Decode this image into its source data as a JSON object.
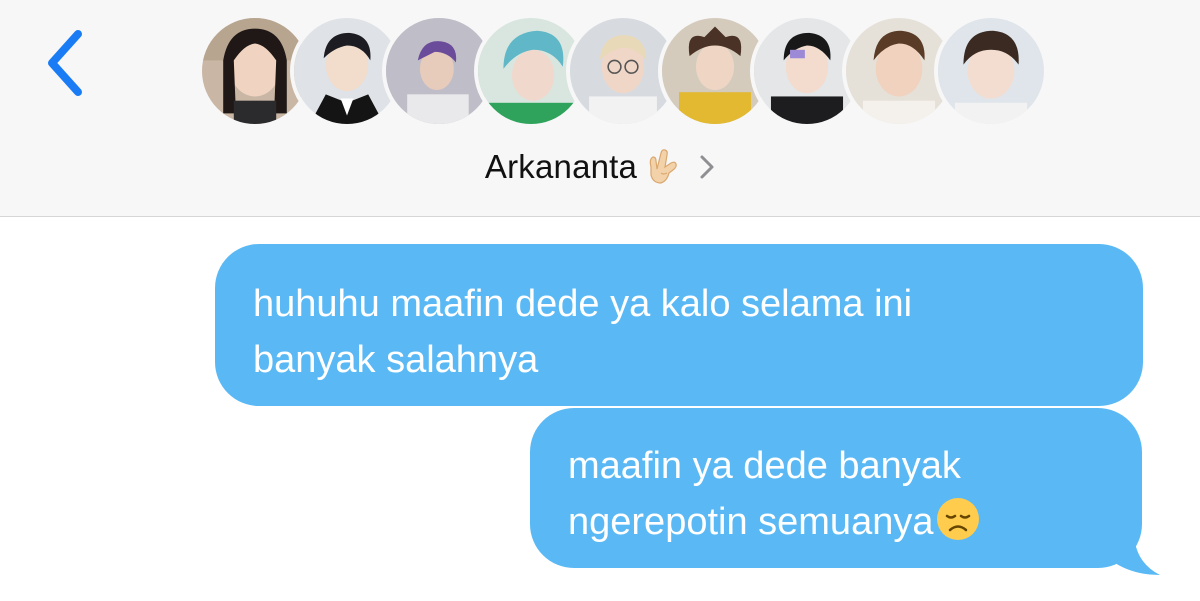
{
  "header": {
    "back_icon": "chevron-left-icon",
    "group_name": "Arkananta",
    "name_emoji": "sign-of-horns-emoji",
    "details_icon": "chevron-right-icon",
    "accent_color": "#1a7cf5",
    "participant_count": 9
  },
  "messages": [
    {
      "lines": [
        "huhuhu maafin dede ya kalo selama ini",
        "banyak salahnya"
      ],
      "direction": "outgoing",
      "color": "#5ab9f5"
    },
    {
      "lines": [
        "maafin ya dede banyak",
        "ngerepotin semuanya"
      ],
      "emoji": "disappointed-face-emoji",
      "direction": "outgoing",
      "color": "#5ab9f5"
    }
  ]
}
